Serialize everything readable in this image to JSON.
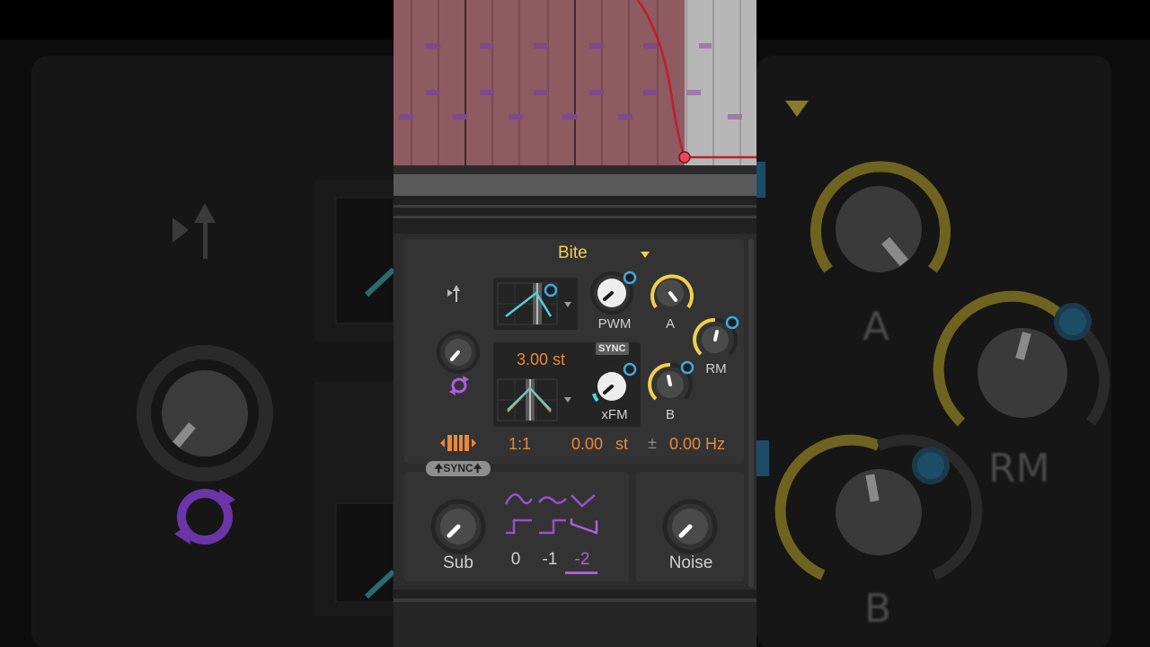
{
  "background": {
    "labels": {
      "a": "A",
      "rm": "RM",
      "b": "B"
    }
  },
  "automation": {
    "curve_color": "#c21d2d"
  },
  "oscillator": {
    "preset_name": "Bite",
    "knobs": {
      "pwm": "PWM",
      "a": "A",
      "rm": "RM",
      "xfm": "xFM",
      "b": "B"
    },
    "sync_badge": "SYNC",
    "pitch_value": "3.00 st",
    "ratio": "1:1",
    "fine_value": "0.00",
    "fine_unit": "st",
    "plus_minus": "±",
    "hz_value": "0.00 Hz"
  },
  "sub": {
    "sync_tab": "SYNC",
    "label": "Sub",
    "octaves": [
      "0",
      "-1",
      "-2"
    ],
    "selected_octave": "-2"
  },
  "noise": {
    "label": "Noise"
  },
  "colors": {
    "accent_yellow": "#f1cf4e",
    "accent_orange": "#e8883a",
    "accent_purple": "#b05ce0",
    "mod_blue": "#3fa9e0",
    "wave_cyan": "#4fd1d9"
  }
}
